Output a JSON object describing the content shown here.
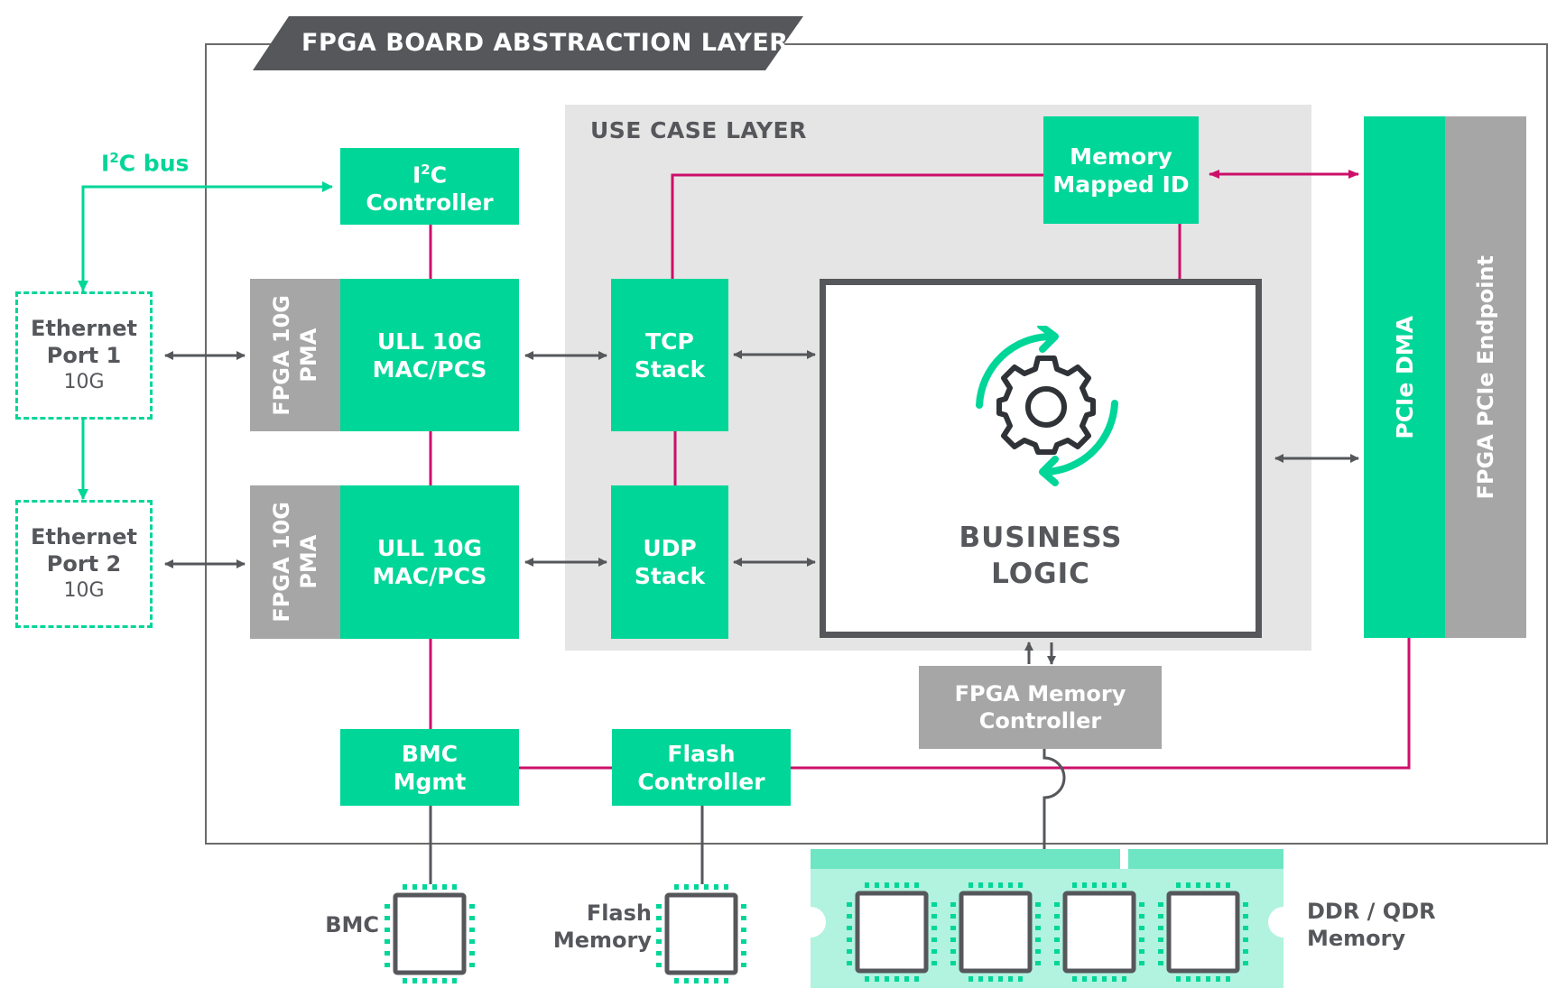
{
  "title": "FPGA BOARD ABSTRACTION LAYER",
  "use_case_layer": {
    "label": "USE CASE LAYER"
  },
  "i2c_bus": {
    "label_prefix": "I",
    "label_sup": "2",
    "label_suffix": "C bus"
  },
  "ethernet_ports": [
    {
      "line1": "Ethernet",
      "line2": "Port 1",
      "speed": "10G"
    },
    {
      "line1": "Ethernet",
      "line2": "Port 2",
      "speed": "10G"
    }
  ],
  "blocks": {
    "i2c_controller": {
      "prefix": "I",
      "sup": "2",
      "suffix": "C",
      "line2": "Controller"
    },
    "pma": [
      {
        "line1": "FPGA 10G",
        "line2": "PMA"
      },
      {
        "line1": "FPGA 10G",
        "line2": "PMA"
      }
    ],
    "mac_pcs": [
      {
        "line1": "ULL 10G",
        "line2": "MAC/PCS"
      },
      {
        "line1": "ULL 10G",
        "line2": "MAC/PCS"
      }
    ],
    "tcp": {
      "line1": "TCP",
      "line2": "Stack"
    },
    "udp": {
      "line1": "UDP",
      "line2": "Stack"
    },
    "memory_mapped_id": {
      "line1": "Memory",
      "line2": "Mapped ID"
    },
    "business_logic": {
      "line1": "BUSINESS",
      "line2": "LOGIC",
      "icon": "gear-cycle-icon"
    },
    "pcie_dma": {
      "label": "PCIe DMA"
    },
    "pcie_endpoint": {
      "label": "FPGA PCIe Endpoint"
    },
    "memory_controller": {
      "line1": "FPGA Memory",
      "line2": "Controller"
    },
    "bmc_mgmt": {
      "line1": "BMC",
      "line2": "Mgmt"
    },
    "flash_controller": {
      "line1": "Flash",
      "line2": "Controller"
    }
  },
  "external": {
    "bmc": {
      "label": "BMC"
    },
    "flash_memory": {
      "line1": "Flash",
      "line2": "Memory"
    },
    "ddr_memory": {
      "line1": "DDR / QDR",
      "line2": "Memory",
      "chip_count": 4
    }
  },
  "colors": {
    "green": "#00d698",
    "gray_block": "#a7a6a7",
    "dark": "#55575b",
    "magenta": "#cc0f6a",
    "use_case_bg": "#e5e5e5",
    "ddr_light": "#b1f3de",
    "ddr_strip": "#6ee6c4"
  }
}
